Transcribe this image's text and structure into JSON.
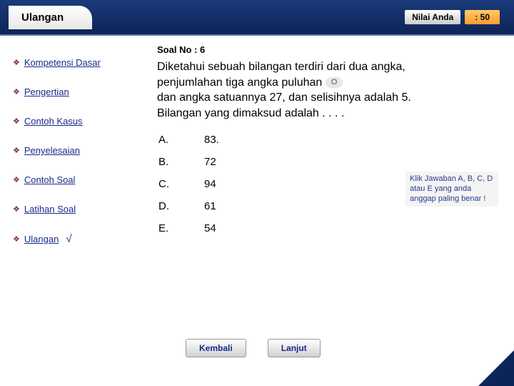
{
  "header": {
    "tab": "Ulangan",
    "score_label": "Nilai Anda",
    "score_value": ": 50"
  },
  "sidebar": {
    "items": [
      {
        "label": "Kompetensi Dasar"
      },
      {
        "label": "Pengertian"
      },
      {
        "label": "Contoh Kasus"
      },
      {
        "label": "Penyelesaian"
      },
      {
        "label": "Contoh Soal"
      },
      {
        "label": "Latihan Soal"
      },
      {
        "label": "Ulangan",
        "checked": true
      }
    ]
  },
  "main": {
    "soal_no": "Soal No : 6",
    "question_l1": "Diketahui sebuah bilangan terdiri dari dua angka,",
    "question_l2a": "penjumlahan tiga angka puluhan",
    "question_inline": "O",
    "question_l3": "dan angka satuannya 27, dan selisihnya adalah 5.",
    "question_l4": "Bilangan yang dimaksud adalah . . . .",
    "options": [
      {
        "letter": "A.",
        "value": "83."
      },
      {
        "letter": "B.",
        "value": "72"
      },
      {
        "letter": "C.",
        "value": "94"
      },
      {
        "letter": "D.",
        "value": "61"
      },
      {
        "letter": "E.",
        "value": "54"
      }
    ],
    "hint": "Klik Jawaban A, B, C, D atau E yang anda anggap paling benar !",
    "back": "Kembali",
    "next": "Lanjut"
  }
}
